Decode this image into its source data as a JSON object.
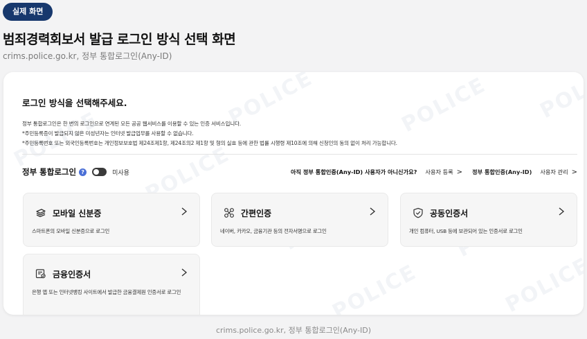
{
  "badge": "실제 화면",
  "page_title": "범죄경력회보서 발급 로그인 방식 선택 화면",
  "page_subtitle": "crims.police.go.kr, 정부 통합로그인(Any-ID)",
  "watermark_text": "POLICE",
  "login": {
    "heading": "로그인 방식을 선택해주세요.",
    "notices": [
      "정부 통합로그인은 한 번의 로그인으로 연계된 모든 공공 웹서비스를 이용할 수 있는 인증 서비스입니다.",
      "*주민등록증이 발급되지 않은 미성년자는 인터넷 발급업무를 사용할 수 없습니다.",
      "*주민등록번호 또는 외국인등록번호는 개인정보보호법 제24조제1항, 제24조의2 제1항 및 형의 실효 등에 관한 법률 시행령 제10조에 의해 신청인의 동의 없이 처리 가능합니다."
    ]
  },
  "anyid": {
    "label": "정부 통합로그인",
    "help_icon": "?",
    "toggle_label": "미사용",
    "question": "아직 정부 통합인증(Any-ID) 사용자가 아니신가요?",
    "register_link": "사용자 등록",
    "anyid_link": "정부 통합인증(Any-ID)",
    "manage_link": "사용자 관리",
    "chevron": ">"
  },
  "options": [
    {
      "title": "모바일 신분증",
      "desc": "스마트폰의 모바일 신분증으로 로그인",
      "icon": "mobile-id-icon"
    },
    {
      "title": "간편인증",
      "desc": "네이버, 카카오, 금융기관 등의 전자서명으로 로그인",
      "icon": "simple-auth-icon"
    },
    {
      "title": "공동인증서",
      "desc": "개인 컴퓨터, USB 등에 보관되어 있는 인증서로 로그인",
      "icon": "shield-check-icon"
    },
    {
      "title": "금융인증서",
      "desc": "은행 앱 또는 인터넷뱅킹 사이트에서 발급한 금융결제원 인증서로 로그인",
      "icon": "finance-cert-icon"
    }
  ],
  "footer": "crims.police.go.kr, 정부 통합로그인(Any-ID)",
  "colors": {
    "badge_bg": "#17386d",
    "page_bg": "#f3f3f4",
    "card_bg": "#ffffff",
    "option_bg": "#f6f6f6",
    "help_icon": "#4a6fd6"
  }
}
